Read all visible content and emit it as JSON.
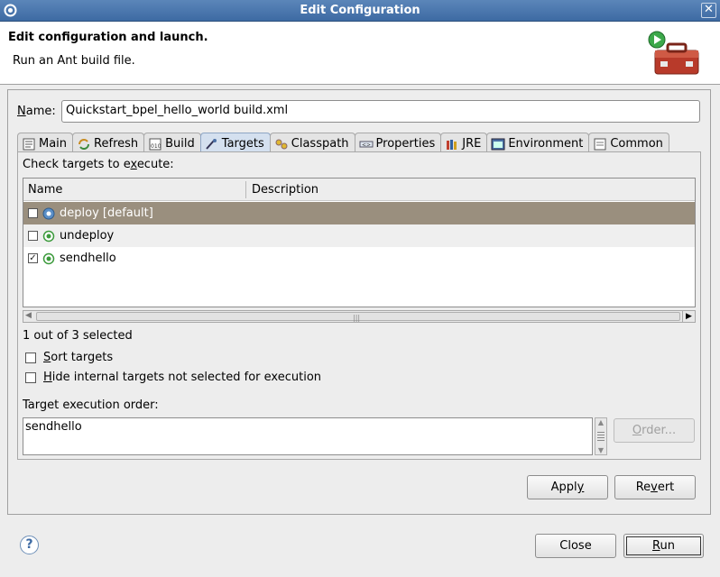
{
  "window": {
    "title": "Edit Configuration",
    "close_glyph": "✕"
  },
  "banner": {
    "heading": "Edit configuration and launch.",
    "subtitle": "Run an Ant build file."
  },
  "name_field": {
    "label_letter": "N",
    "label_rest": "ame:",
    "value": "Quickstart_bpel_hello_world build.xml"
  },
  "tabs": [
    {
      "label": "Main",
      "icon": "main-tab-icon",
      "active": false
    },
    {
      "label": "Refresh",
      "icon": "refresh-icon",
      "active": false
    },
    {
      "label": "Build",
      "icon": "build-icon",
      "active": false
    },
    {
      "label": "Targets",
      "icon": "targets-icon",
      "active": true
    },
    {
      "label": "Classpath",
      "icon": "classpath-icon",
      "active": false
    },
    {
      "label": "Properties",
      "icon": "properties-icon",
      "active": false
    },
    {
      "label": "JRE",
      "icon": "jre-icon",
      "active": false
    },
    {
      "label": "Environment",
      "icon": "environment-icon",
      "active": false
    },
    {
      "label": "Common",
      "icon": "common-icon",
      "active": false
    }
  ],
  "targets": {
    "prompt_a": "Check targets to e",
    "prompt_u": "x",
    "prompt_b": "ecute:",
    "columns": [
      "Name",
      "Description"
    ],
    "rows": [
      {
        "name": "deploy [default]",
        "description": "",
        "checked": false,
        "selected": true,
        "icon": "default-target-icon"
      },
      {
        "name": "undeploy",
        "description": "",
        "checked": false,
        "selected": false,
        "icon": "target-icon"
      },
      {
        "name": "sendhello",
        "description": "",
        "checked": true,
        "selected": false,
        "icon": "target-icon"
      }
    ],
    "summary": "1 out of 3 selected",
    "sort_u": "S",
    "sort_rest": "ort targets",
    "hide_u": "H",
    "hide_rest": "ide internal targets not selected for execution",
    "order_label": "Target execution order:",
    "order_value": "sendhello",
    "order_button_u": "O",
    "order_button_rest": "rder..."
  },
  "buttons": {
    "apply_a": "Appl",
    "apply_u": "y",
    "apply_b": "",
    "revert_a": "Re",
    "revert_u": "v",
    "revert_b": "ert",
    "close": "Close",
    "run_u": "R",
    "run_rest": "un",
    "help": "?"
  },
  "colors": {
    "title_bar": "#3d6aa3",
    "selected_row": "#9a8f7e",
    "active_tab": "#d4e0ef"
  }
}
